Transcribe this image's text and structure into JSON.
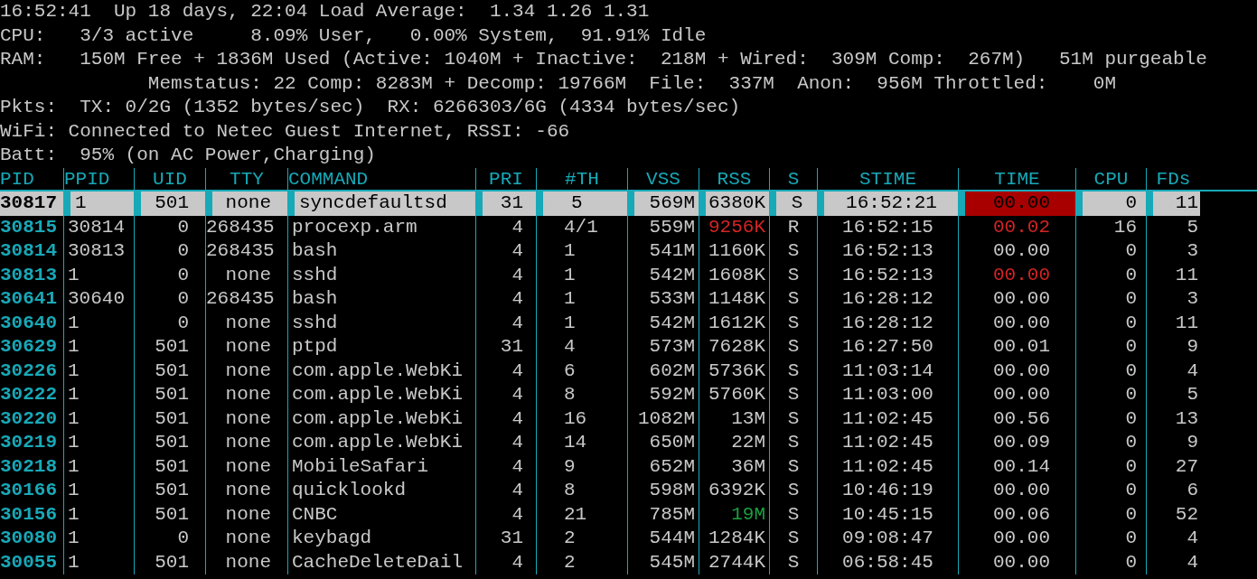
{
  "status_lines": [
    "16:52:41  Up 18 days, 22:04 Load Average:  1.34 1.26 1.31",
    "CPU:   3/3 active     8.09% User,   0.00% System,  91.91% Idle",
    "RAM:   150M Free + 1836M Used (Active: 1040M + Inactive:  218M + Wired:  309M Comp:  267M)   51M purgeable",
    "             Memstatus: 22 Comp: 8283M + Decomp: 19766M  File:  337M  Anon:  956M Throttled:    0M",
    "Pkts:  TX: 0/2G (1352 bytes/sec)  RX: 6266303/6G (4334 bytes/sec)",
    "WiFi: Connected to Netec Guest Internet, RSSI: -66",
    "Batt:  95% (on AC Power,Charging)"
  ],
  "table": {
    "columns": [
      "PID",
      "PPID",
      "UID",
      "TTY",
      "COMMAND",
      "PRI",
      "#TH",
      "VSS",
      "RSS",
      "S",
      "STIME",
      "TIME",
      "CPU",
      "FDs"
    ],
    "rows": [
      {
        "selected": true,
        "cells": [
          "30817",
          "1",
          "501",
          "none",
          "syncdefaultsd",
          "31",
          "5",
          "569M",
          "6380K",
          "S",
          "16:52:21",
          {
            "text": "00.00",
            "color": "#a80000"
          },
          "0",
          "11"
        ]
      },
      {
        "selected": false,
        "cells": [
          "30815",
          "30814",
          "0",
          "268435",
          "procexp.arm",
          "4",
          "4/1",
          "559M",
          {
            "text": "9256K",
            "color": "#d42424"
          },
          "R",
          "16:52:15",
          {
            "text": "00.02",
            "color": "#d42424"
          },
          "16",
          "5"
        ]
      },
      {
        "selected": false,
        "cells": [
          "30814",
          "30813",
          "0",
          "268435",
          "bash",
          "4",
          "1",
          "541M",
          "1160K",
          "S",
          "16:52:13",
          "00.00",
          "0",
          "3"
        ]
      },
      {
        "selected": false,
        "cells": [
          "30813",
          "1",
          "0",
          "none",
          "sshd",
          "4",
          "1",
          "542M",
          "1608K",
          "S",
          "16:52:13",
          {
            "text": "00.00",
            "color": "#d42424"
          },
          "0",
          "11"
        ]
      },
      {
        "selected": false,
        "cells": [
          "30641",
          "30640",
          "0",
          "268435",
          "bash",
          "4",
          "1",
          "533M",
          "1148K",
          "S",
          "16:28:12",
          "00.00",
          "0",
          "3"
        ]
      },
      {
        "selected": false,
        "cells": [
          "30640",
          "1",
          "0",
          "none",
          "sshd",
          "4",
          "1",
          "542M",
          "1612K",
          "S",
          "16:28:12",
          "00.00",
          "0",
          "11"
        ]
      },
      {
        "selected": false,
        "cells": [
          "30629",
          "1",
          "501",
          "none",
          "ptpd",
          "31",
          "4",
          "573M",
          "7628K",
          "S",
          "16:27:50",
          "00.01",
          "0",
          "9"
        ]
      },
      {
        "selected": false,
        "cells": [
          "30226",
          "1",
          "501",
          "none",
          "com.apple.WebKi",
          "4",
          "6",
          "602M",
          "5736K",
          "S",
          "11:03:14",
          "00.00",
          "0",
          "4"
        ]
      },
      {
        "selected": false,
        "cells": [
          "30222",
          "1",
          "501",
          "none",
          "com.apple.WebKi",
          "4",
          "8",
          "592M",
          "5760K",
          "S",
          "11:03:00",
          "00.00",
          "0",
          "5"
        ]
      },
      {
        "selected": false,
        "cells": [
          "30220",
          "1",
          "501",
          "none",
          "com.apple.WebKi",
          "4",
          "16",
          "1082M",
          "13M",
          "S",
          "11:02:45",
          "00.56",
          "0",
          "13"
        ]
      },
      {
        "selected": false,
        "cells": [
          "30219",
          "1",
          "501",
          "none",
          "com.apple.WebKi",
          "4",
          "14",
          "650M",
          "22M",
          "S",
          "11:02:45",
          "00.09",
          "0",
          "9"
        ]
      },
      {
        "selected": false,
        "cells": [
          "30218",
          "1",
          "501",
          "none",
          "MobileSafari",
          "4",
          "9",
          "652M",
          "36M",
          "S",
          "11:02:45",
          "00.14",
          "0",
          "27"
        ]
      },
      {
        "selected": false,
        "cells": [
          "30166",
          "1",
          "501",
          "none",
          "quicklookd",
          "4",
          "8",
          "598M",
          "6392K",
          "S",
          "10:46:19",
          "00.00",
          "0",
          "6"
        ]
      },
      {
        "selected": false,
        "cells": [
          "30156",
          "1",
          "501",
          "none",
          "CNBC",
          "4",
          "21",
          "785M",
          {
            "text": "19M",
            "color": "#1aa040"
          },
          "S",
          "10:45:15",
          "00.06",
          "0",
          "52"
        ]
      },
      {
        "selected": false,
        "cells": [
          "30080",
          "1",
          "0",
          "none",
          "keybagd",
          "31",
          "2",
          "544M",
          "1284K",
          "S",
          "09:08:47",
          "00.00",
          "0",
          "4"
        ]
      },
      {
        "selected": false,
        "cells": [
          "30055",
          "1",
          "501",
          "none",
          "CacheDeleteDail",
          "4",
          "2",
          "545M",
          "2744K",
          "S",
          "06:58:45",
          "00.00",
          "0",
          "4"
        ]
      }
    ]
  }
}
